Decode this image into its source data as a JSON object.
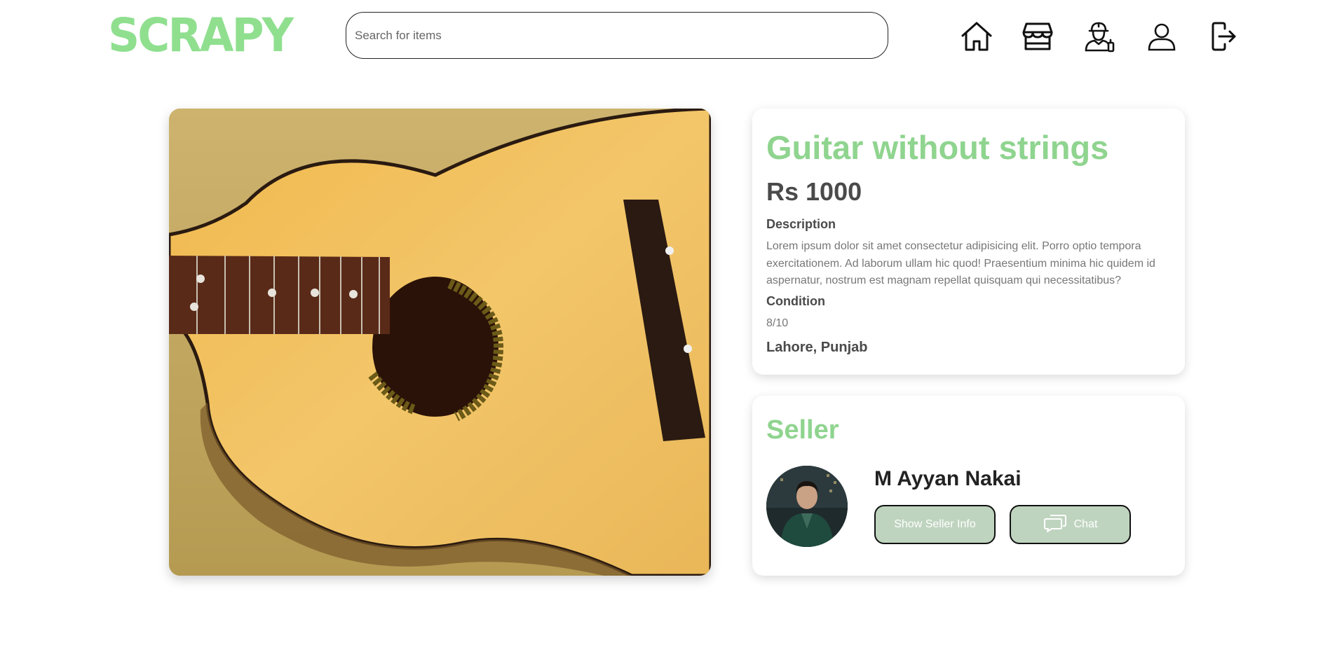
{
  "header": {
    "logo": "SCRAPY",
    "search": {
      "placeholder": "Search for items",
      "value": ""
    },
    "nav_icons": [
      "home-icon",
      "store-icon",
      "worker-icon",
      "user-icon",
      "logout-icon"
    ]
  },
  "product": {
    "title": "Guitar without strings",
    "price": "Rs 1000",
    "description_label": "Description",
    "description": "Lorem ipsum dolor sit amet consectetur adipisicing elit. Porro optio tempora exercitationem. Ad laborum ullam hic quod! Praesentium minima hic quidem id aspernatur, nostrum est magnam repellat quisquam qui necessitatibus?",
    "condition_label": "Condition",
    "condition": "8/10",
    "location": "Lahore, Punjab"
  },
  "seller": {
    "heading": "Seller",
    "name": "M Ayyan Nakai",
    "info_button": "Show Seller Info",
    "chat_button": "Chat"
  },
  "colors": {
    "brand_green": "#8fdf8f",
    "heading_green": "#8fd48f",
    "button_bg": "#bfd4bf",
    "text_dark": "#4a4a4a",
    "text_muted": "#777777"
  }
}
